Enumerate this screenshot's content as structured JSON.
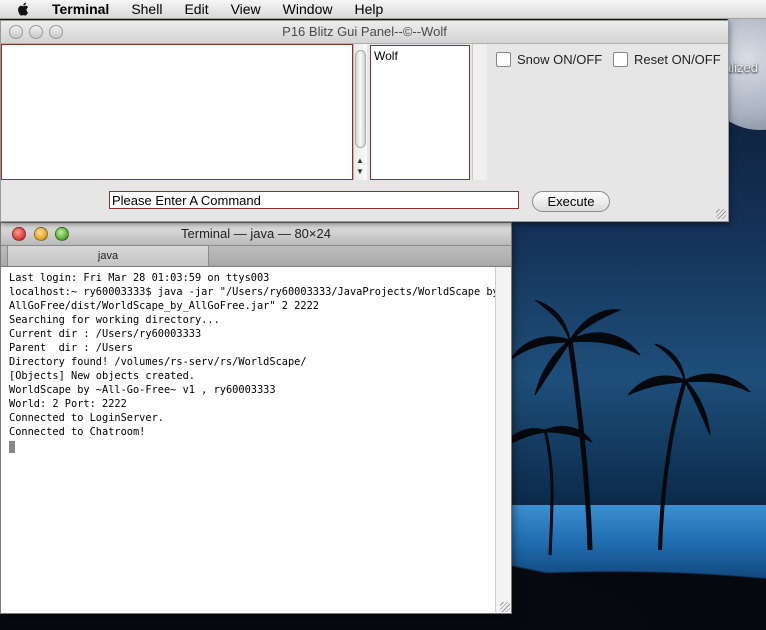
{
  "menubar": {
    "app_name": "Terminal",
    "items": [
      "Shell",
      "Edit",
      "View",
      "Window",
      "Help"
    ]
  },
  "desktop": {
    "partial_label": "alized"
  },
  "java_window": {
    "title": "P16 Blitz Gui Panel--©--Wolf",
    "users": [
      "Wolf"
    ],
    "snow_label": "Snow ON/OFF",
    "reset_label": "Reset ON/OFF",
    "command_value": "Please Enter A Command",
    "execute_label": "Execute"
  },
  "terminal": {
    "title": "Terminal — java — 80×24",
    "tab_label": "java",
    "lines": [
      "Last login: Fri Mar 28 01:03:59 on ttys003",
      "localhost:~ ry60003333$ java -jar \"/Users/ry60003333/JavaProjects/WorldScape by",
      "AllGoFree/dist/WorldScape_by_AllGoFree.jar\" 2 2222",
      "Searching for working directory...",
      "Current dir : /Users/ry60003333",
      "Parent  dir : /Users",
      "Directory found! /volumes/rs-serv/rs/WorldScape/",
      "[Objects] New objects created.",
      "WorldScape by ~All-Go-Free~ v1 , ry60003333",
      "World: 2 Port: 2222",
      "Connected to LoginServer.",
      "Connected to Chatroom!"
    ]
  },
  "colors": {
    "close": "#e0443e",
    "minimize": "#e9a92c",
    "zoom": "#5cb533",
    "field_border": "#8a3030"
  }
}
